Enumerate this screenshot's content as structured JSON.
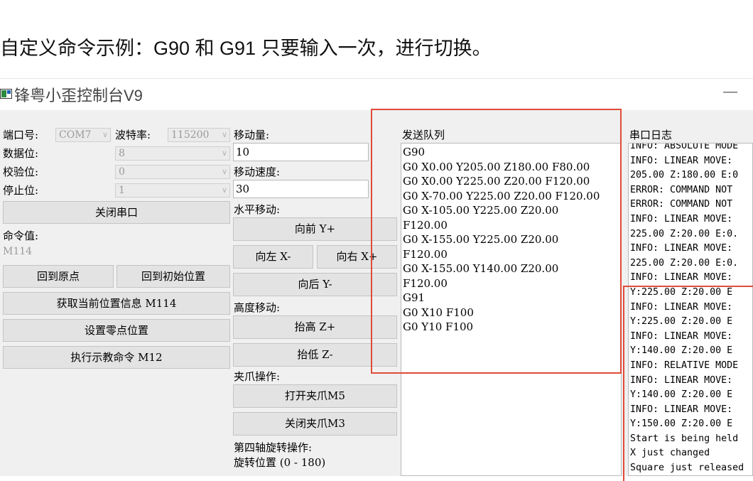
{
  "caption": "自定义命令示例：G90 和 G91 只要输入一次，进行切换。",
  "window": {
    "title": "锋粤小歪控制台V9",
    "minimize": "—",
    "icon": "app-window-icon"
  },
  "serial": {
    "port_label": "端口号:",
    "port_value": "COM7",
    "baud_label": "波特率:",
    "baud_value": "115200",
    "databits_label": "数据位:",
    "databits_value": "8",
    "parity_label": "校验位:",
    "parity_value": "0",
    "stopbits_label": "停止位:",
    "stopbits_value": "1",
    "close_port_button": "关闭串口"
  },
  "command": {
    "label": "命令值:",
    "value": "M114",
    "home_button": "回到原点",
    "initial_button": "回到初始位置",
    "get_position_button": "获取当前位置信息 M114",
    "set_zero_button": "设置零点位置",
    "teach_button": "执行示教命令 M12"
  },
  "movement": {
    "amount_label": "移动量:",
    "amount_value": "10",
    "speed_label": "移动速度:",
    "speed_value": "30",
    "horizontal_label": "水平移动:",
    "forward_button": "向前 Y+",
    "left_button": "向左 X-",
    "right_button": "向右 X+",
    "back_button": "向后 Y-",
    "height_label": "高度移动:",
    "up_button": "抬高 Z+",
    "down_button": "抬低 Z-",
    "gripper_label": "夹爪操作:",
    "open_gripper_button": "打开夹爪M5",
    "close_gripper_button": "关闭夹爪M3",
    "rotation_label": "第四轴旋转操作:",
    "rotation_range_label": "旋转位置 (0 - 180)"
  },
  "queue": {
    "label": "发送队列",
    "lines": [
      "G90",
      "G0 X0.00 Y205.00 Z180.00 F80.00",
      "G0 X0.00 Y225.00 Z20.00 F120.00",
      "G0 X-70.00 Y225.00 Z20.00 F120.00",
      "G0 X-105.00 Y225.00 Z20.00",
      "F120.00",
      "G0 X-155.00 Y225.00 Z20.00",
      "F120.00",
      "G0 X-155.00 Y140.00 Z20.00",
      "F120.00",
      "G91",
      "G0 X10 F100",
      "G0 Y10 F100"
    ]
  },
  "log": {
    "label": "串口日志",
    "lines": [
      "INFO: ABSOLUTE MODE",
      "INFO: LINEAR MOVE:",
      "205.00 Z:180.00 E:0",
      "ERROR: COMMAND NOT",
      "ERROR: COMMAND NOT",
      "INFO: LINEAR MOVE:",
      "225.00 Z:20.00 E:0.",
      "INFO: LINEAR MOVE:",
      "225.00 Z:20.00 E:0.",
      "INFO: LINEAR MOVE:",
      "Y:225.00 Z:20.00 E",
      "INFO: LINEAR MOVE:",
      "Y:225.00 Z:20.00 E",
      "INFO: LINEAR MOVE:",
      "Y:140.00 Z:20.00 E",
      "INFO: RELATIVE MODE",
      "INFO: LINEAR MOVE:",
      "Y:140.00 Z:20.00 E",
      "INFO: LINEAR MOVE:",
      "Y:150.00 Z:20.00 E",
      "Start is being held",
      "X just changed",
      "Square just released"
    ]
  },
  "colors": {
    "highlight": "#e04b3a",
    "client_bg": "#f0f0f0",
    "button_bg": "#e3e3e3"
  }
}
